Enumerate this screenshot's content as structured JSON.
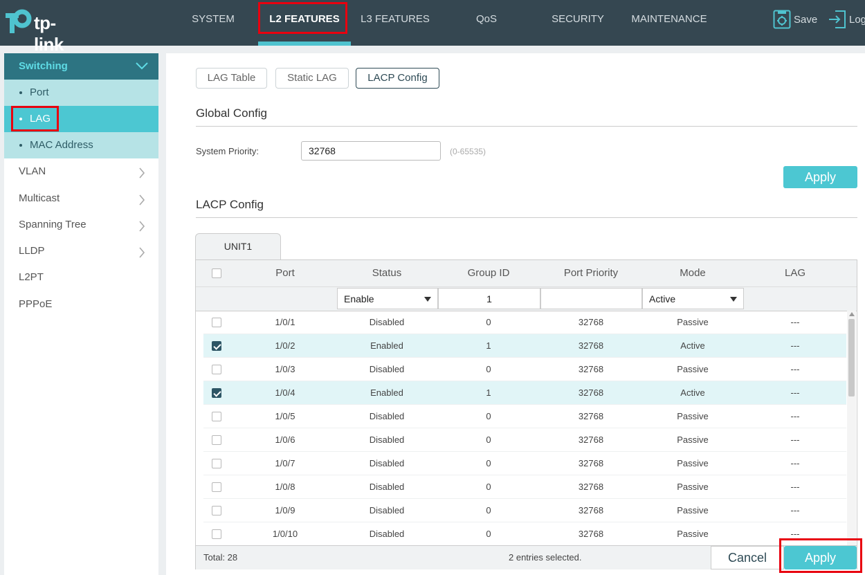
{
  "brand": {
    "name": "tp-link"
  },
  "nav": {
    "items": [
      "SYSTEM",
      "L2 FEATURES",
      "L3 FEATURES",
      "QoS",
      "SECURITY",
      "MAINTENANCE"
    ],
    "active": "L2 FEATURES"
  },
  "toolbar": {
    "save_label": "Save",
    "logout_label": "Log"
  },
  "sidebar": {
    "section": "Switching",
    "subitems": [
      "Port",
      "LAG",
      "MAC Address"
    ],
    "selected": "LAG",
    "items": [
      "VLAN",
      "Multicast",
      "Spanning Tree",
      "LLDP",
      "L2PT",
      "PPPoE"
    ]
  },
  "tabs": {
    "labels": [
      "LAG Table",
      "Static LAG",
      "LACP Config"
    ],
    "active": "LACP Config"
  },
  "global_config": {
    "title": "Global Config",
    "label": "System Priority:",
    "value": "32768",
    "hint": "(0-65535)",
    "apply_label": "Apply"
  },
  "lacp": {
    "title": "LACP Config",
    "unit_tab": "UNIT1",
    "columns": [
      "Port",
      "Status",
      "Group ID",
      "Port Priority",
      "Mode",
      "LAG"
    ],
    "filter": {
      "status": "Enable",
      "group_id": "1",
      "port_priority": "",
      "mode": "Active"
    },
    "rows": [
      {
        "checked": false,
        "port": "1/0/1",
        "status": "Disabled",
        "group_id": "0",
        "priority": "32768",
        "mode": "Passive",
        "lag": "---"
      },
      {
        "checked": true,
        "port": "1/0/2",
        "status": "Enabled",
        "group_id": "1",
        "priority": "32768",
        "mode": "Active",
        "lag": "---"
      },
      {
        "checked": false,
        "port": "1/0/3",
        "status": "Disabled",
        "group_id": "0",
        "priority": "32768",
        "mode": "Passive",
        "lag": "---"
      },
      {
        "checked": true,
        "port": "1/0/4",
        "status": "Enabled",
        "group_id": "1",
        "priority": "32768",
        "mode": "Active",
        "lag": "---"
      },
      {
        "checked": false,
        "port": "1/0/5",
        "status": "Disabled",
        "group_id": "0",
        "priority": "32768",
        "mode": "Passive",
        "lag": "---"
      },
      {
        "checked": false,
        "port": "1/0/6",
        "status": "Disabled",
        "group_id": "0",
        "priority": "32768",
        "mode": "Passive",
        "lag": "---"
      },
      {
        "checked": false,
        "port": "1/0/7",
        "status": "Disabled",
        "group_id": "0",
        "priority": "32768",
        "mode": "Passive",
        "lag": "---"
      },
      {
        "checked": false,
        "port": "1/0/8",
        "status": "Disabled",
        "group_id": "0",
        "priority": "32768",
        "mode": "Passive",
        "lag": "---"
      },
      {
        "checked": false,
        "port": "1/0/9",
        "status": "Disabled",
        "group_id": "0",
        "priority": "32768",
        "mode": "Passive",
        "lag": "---"
      },
      {
        "checked": false,
        "port": "1/0/10",
        "status": "Disabled",
        "group_id": "0",
        "priority": "32768",
        "mode": "Passive",
        "lag": "---"
      }
    ],
    "total_text": "Total: 28",
    "selected_text": "2 entries selected.",
    "cancel_label": "Cancel",
    "apply_label": "Apply"
  },
  "colors": {
    "topbar": "#354751",
    "accent": "#4cc7d2",
    "highlight": "#e8000f"
  }
}
